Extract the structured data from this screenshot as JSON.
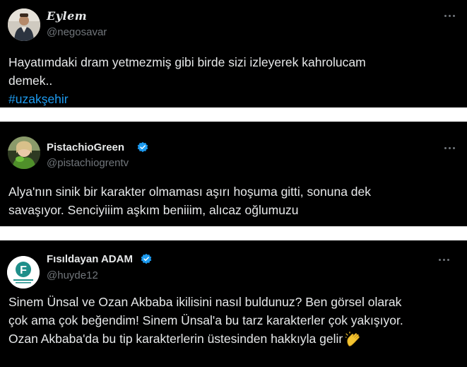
{
  "tweets": [
    {
      "display_name": "Eylem",
      "handle": "@negosavar",
      "lines": [
        "Hayatımdaki dram yetmezmiş gibi birde sizi izleyerek kahrolucam",
        "demek.."
      ],
      "hashtag": "#uzakşehir",
      "verified": false,
      "avatar_icon": "person-avatar"
    },
    {
      "display_name": "PistachioGreen",
      "handle": "@pistachiogrentv",
      "lines": [
        "Alya'nın sinik bir karakter olmaması aşırı hoşuma gitti, sonuna dek",
        "savaşıyor. Senciyiiim aşkım beniiim, alıcaz oğlumuzu"
      ],
      "verified": true,
      "avatar_icon": "green-character-avatar"
    },
    {
      "display_name": "Fısıldayan ADAM",
      "handle": "@huyde12",
      "lines": [
        "Sinem Ünsal ve Ozan Akbaba ikilisini nasıl buldunuz? Ben görsel olarak",
        "çok ama çok beğendim! Sinem Ünsal'a bu tarz karakterler çok yakışıyor.",
        "Ozan Akbaba'da bu tip karakterlerin üstesinden hakkıyla gelir"
      ],
      "verified": true,
      "avatar_icon": "fisildayan-logo-avatar",
      "avatar_logo_letter": "F",
      "trailing_emoji": "clapping-hands-icon"
    }
  ],
  "colors": {
    "background": "#000000",
    "text": "#e7e9ea",
    "secondary": "#71767b",
    "accent": "#1d9bf0",
    "separator": "#ffffff"
  }
}
